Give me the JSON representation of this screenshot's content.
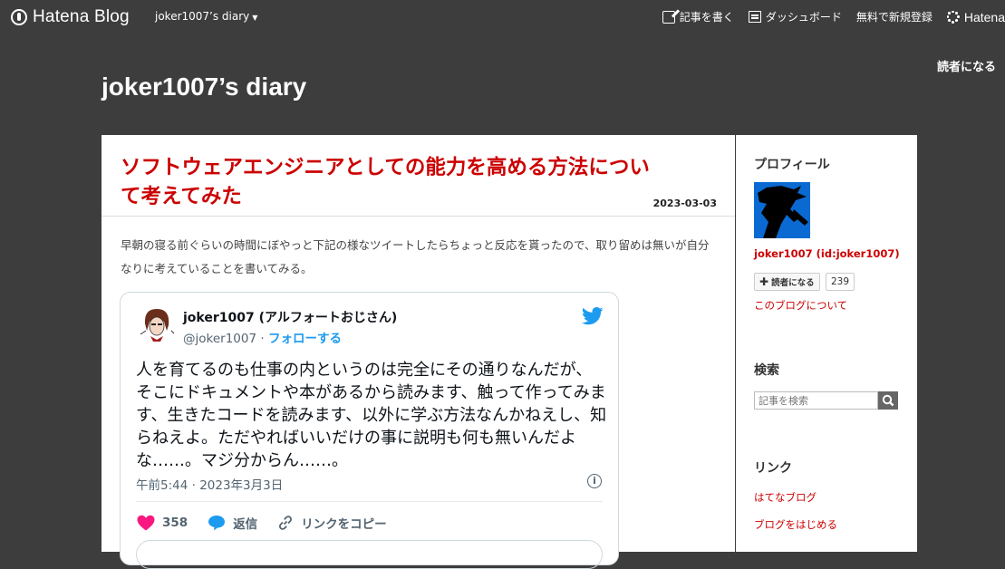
{
  "globalbar": {
    "logo": "Hatena Blog",
    "blog_menu": "joker1007’s diary",
    "write": "記事を書く",
    "dashboard": "ダッシュボード",
    "register": "無料で新規登録",
    "hatena": "Hatena"
  },
  "subscribe_top": "読者になる",
  "blog_title": "joker1007’s diary",
  "entry": {
    "title": "ソフトウェアエンジニアとしての能力を高める方法について考えてみた",
    "date": "2023-03-03",
    "intro": "早朝の寝る前ぐらいの時間にぼやっと下記の様なツイートしたらちょっと反応を貰ったので、取り留めは無いが自分なりに考えていることを書いてみる。"
  },
  "tweet": {
    "name": "joker1007 (アルフォートおじさん)",
    "handle": "@joker1007",
    "separator": "·",
    "follow": "フォローする",
    "text": "人を育てるのも仕事の内というのは完全にその通りなんだが、そこにドキュメントや本があるから読みます、触って作ってみます、生きたコードを読みます、以外に学ぶ方法なんかねえし、知らねえよ。ただやればいいだけの事に説明も何も無いんだよな……。マジ分からん……。",
    "time": "午前5:44 · 2023年3月3日",
    "likes": "358",
    "reply": "返信",
    "copy_link": "リンクをコピー",
    "colors": {
      "like": "#f91880",
      "reply": "#1d9bf0",
      "bird": "#1d9bf0"
    }
  },
  "sidebar": {
    "profile_heading": "プロフィール",
    "profile_name": "joker1007 (id:joker1007)",
    "subscribe_label": "読者になる",
    "subscriber_count": "239",
    "about_link": "このブログについて",
    "search_heading": "検索",
    "search_placeholder": "記事を検索",
    "links_heading": "リンク",
    "links": [
      "はてなブログ",
      "ブログをはじめる"
    ]
  }
}
